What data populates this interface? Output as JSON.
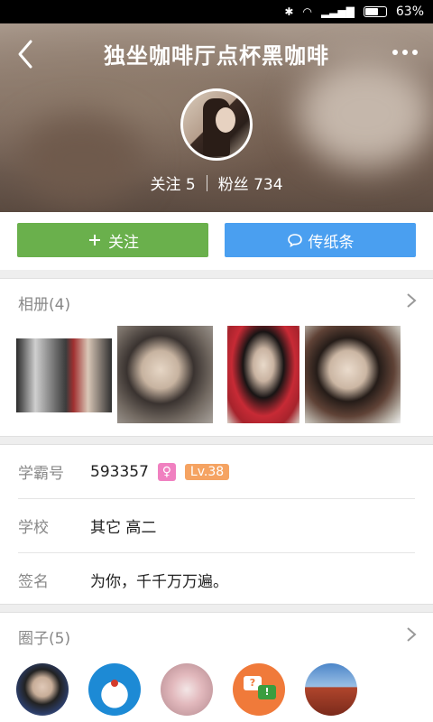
{
  "status_bar": {
    "battery_percent": "63%",
    "battery_level": 0.63,
    "icons": [
      "bluetooth-icon",
      "wifi-icon",
      "signal-icon",
      "battery-icon"
    ]
  },
  "header": {
    "title": "独坐咖啡厅点杯黑咖啡",
    "follow_text": "关注 5",
    "fans_text": "粉丝 734"
  },
  "actions": {
    "follow_label": "关注",
    "note_label": "传纸条"
  },
  "album": {
    "title": "相册(4)",
    "photo_count": 4
  },
  "info": {
    "rows": [
      {
        "label": "学霸号",
        "value": "593357",
        "gender_symbol": "♀",
        "level": "Lv.38"
      },
      {
        "label": "学校",
        "value": "其它 高二"
      },
      {
        "label": "签名",
        "value": "为你，千千万万遍。"
      }
    ]
  },
  "circles": {
    "title": "圈子(5)",
    "count": 5
  },
  "colors": {
    "follow_green": "#6ab04c",
    "note_blue": "#4a9ff0",
    "gender_pink": "#f080c0",
    "level_orange": "#f5a362"
  }
}
